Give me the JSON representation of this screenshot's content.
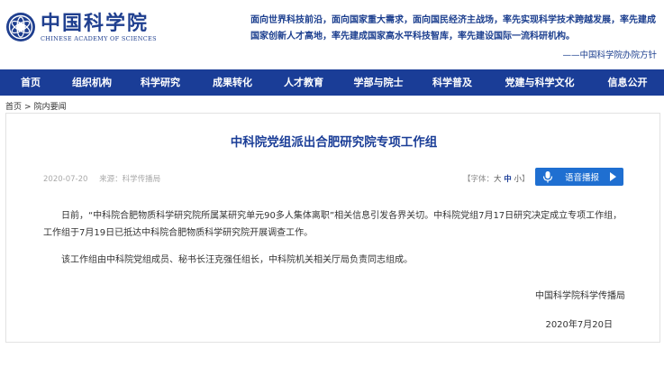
{
  "header": {
    "logo_cn": "中国科学院",
    "logo_en": "CHINESE ACADEMY OF SCIENCES",
    "slogan": "面向世界科技前沿，面向国家重大需求，面向国民经济主战场，率先实现科学技术跨越发展，率先建成国家创新人才高地，率先建成国家高水平科技智库，率先建设国际一流科研机构。",
    "slogan_sign": "——中国科学院办院方针"
  },
  "nav": {
    "items": [
      "首页",
      "组织机构",
      "科学研究",
      "成果转化",
      "人才教育",
      "学部与院士",
      "科学普及",
      "党建与科学文化",
      "信息公开"
    ]
  },
  "breadcrumb": {
    "home": "首页",
    "separator": ">",
    "current": "院内要闻"
  },
  "article": {
    "title": "中科院党组派出合肥研究院专项工作组",
    "date": "2020-07-20",
    "source": "来源：科学传播局",
    "font_label_prefix": "【字体：",
    "font_large": "大",
    "font_medium": "中",
    "font_small": "小",
    "font_label_suffix": "】",
    "voice_label": "语音播报",
    "paragraphs": [
      "日前，“中科院合肥物质科学研究院所属某研究单元90多人集体离职”相关信息引发各界关切。中科院党组7月17日研究决定成立专项工作组，工作组于7月19日已抵达中科院合肥物质科学研究院开展调查工作。",
      "该工作组由中科院党组成员、秘书长汪克强任组长，中科院机关相关厅局负责同志组成。"
    ],
    "sign_org": "中国科学院科学传播局",
    "sign_date": "2020年7月20日"
  },
  "colors": {
    "brand_blue": "#1a3d97",
    "voice_blue": "#1f6fd1"
  }
}
